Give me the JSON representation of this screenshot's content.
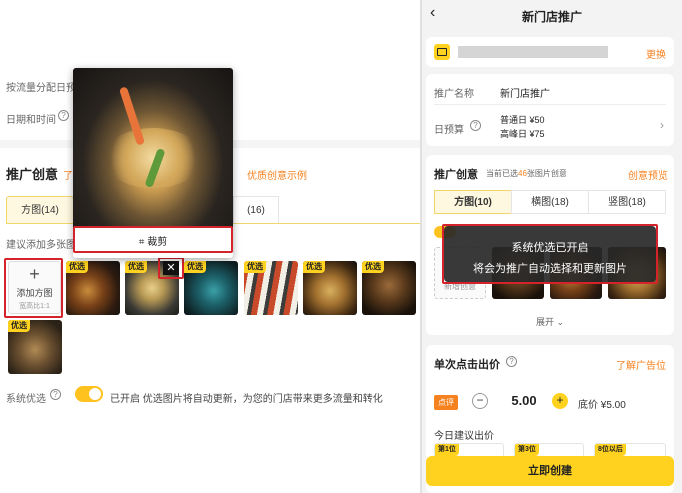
{
  "left": {
    "traffic_text": "按流量分配日预",
    "date_label": "日期和时间",
    "creative_title": "推广创意",
    "creative_hint_partial": "了",
    "creative_example_link": "优质创意示例",
    "tabs": [
      "方图(14)",
      "(16)"
    ],
    "suggest_text": "建议添加多张图",
    "add_tile": {
      "label": "添加方图",
      "sub": "宽高比1:1"
    },
    "badge": "优选",
    "crop_label": "裁剪",
    "system_label": "系统优选",
    "system_desc": "已开启 优选图片将自动更新，为您的门店带来更多流量和转化"
  },
  "right": {
    "header_title": "新门店推广",
    "store_change": "更换",
    "name_label": "推广名称",
    "name_value": "新门店推广",
    "budget_label": "日预算",
    "budget_weekday": "普通日 ¥50",
    "budget_peak": "高峰日 ¥75",
    "creative_title": "推广创意",
    "creative_count_prefix": "当前已选",
    "creative_count": "46",
    "creative_count_suffix": "张图片创意",
    "creative_preview": "创意预览",
    "tabs": [
      "方图(10)",
      "横图(18)",
      "竖图(18)"
    ],
    "add_creative": "新增创意",
    "expand": "展开",
    "toast_line1": "系统优选已开启",
    "toast_line2": "将会为推广自动选择和更新图片",
    "bid_title": "单次点击出价",
    "bid_learn": "了解广告位",
    "bid_tag": "点评",
    "bid_value": "5.00",
    "bid_floor": "底价 ¥5.00",
    "today_bid": "今日建议出价",
    "rank_labels": [
      "第1位",
      "第3位",
      "8位以后"
    ],
    "create_button": "立即创建"
  }
}
